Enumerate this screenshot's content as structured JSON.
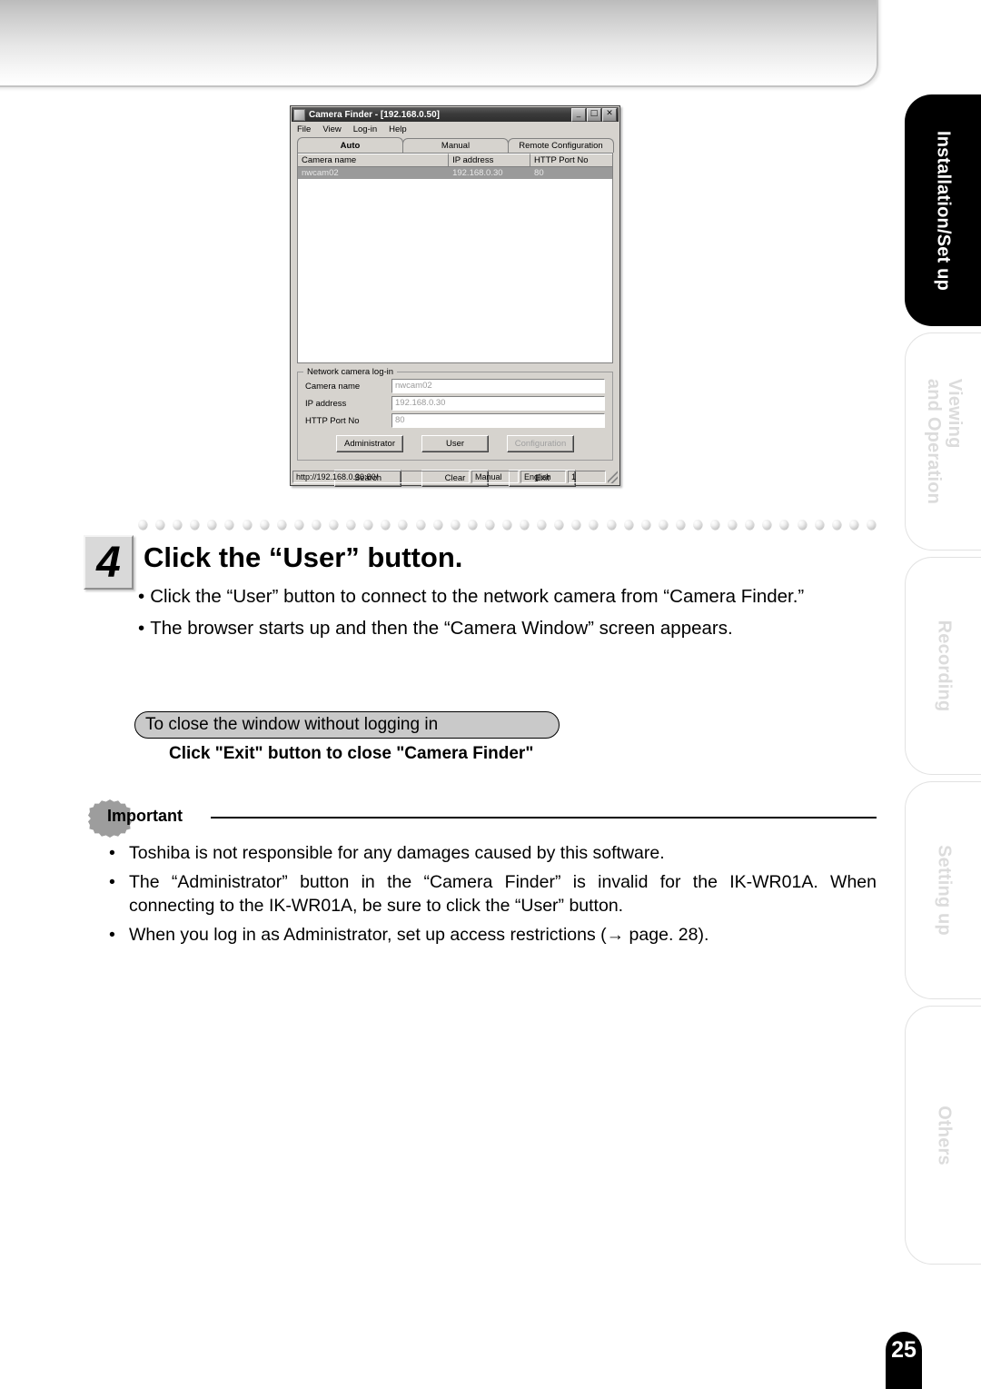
{
  "page": {
    "number": "25"
  },
  "side_tabs": [
    {
      "label": "Installation/Set up",
      "active": true
    },
    {
      "label": "Viewing\nand Operation",
      "active": false
    },
    {
      "label": "Recording",
      "active": false
    },
    {
      "label": "Setting up",
      "active": false
    },
    {
      "label": "Others",
      "active": false
    }
  ],
  "side_tabs_text": {
    "t0": "Installation/Set up",
    "t1_line1": "Viewing",
    "t1_line2": "and Operation",
    "t2": "Recording",
    "t3": "Setting up",
    "t4": "Others"
  },
  "dialog": {
    "title": "Camera Finder  -  [192.168.0.50]",
    "window_buttons": {
      "minimize": "_",
      "maximize": "□",
      "close": "✕"
    },
    "menu": [
      "File",
      "View",
      "Log-in",
      "Help"
    ],
    "tabs": [
      {
        "label": "Auto",
        "selected": true
      },
      {
        "label": "Manual",
        "selected": false
      },
      {
        "label": "Remote Configuration",
        "selected": false
      }
    ],
    "list": {
      "columns": [
        "Camera name",
        "IP address",
        "HTTP Port No"
      ],
      "rows": [
        {
          "camera_name": "nwcam02",
          "ip_address": "192.168.0.30",
          "http_port": "80",
          "selected": true
        }
      ]
    },
    "group": {
      "legend": "Network camera log-in",
      "fields": [
        {
          "label": "Camera name",
          "value": "nwcam02"
        },
        {
          "label": "IP address",
          "value": "192.168.0.30"
        },
        {
          "label": "HTTP Port No",
          "value": "80"
        }
      ],
      "buttons": [
        {
          "label": "Administrator",
          "disabled": false
        },
        {
          "label": "User",
          "disabled": false
        },
        {
          "label": "Configuration",
          "disabled": true
        }
      ]
    },
    "bottom_buttons": [
      {
        "label": "Search"
      },
      {
        "label": "Clear"
      },
      {
        "label": "Exit"
      }
    ],
    "statusbar": {
      "url": "http://192.168.0.30:80/",
      "mode": "Manual",
      "language": "English",
      "count": "1"
    }
  },
  "step": {
    "number": "4",
    "title": "Click the “User” button.",
    "bullets": [
      "Click the “User” button to connect to the network camera from “Camera Finder.”",
      "The browser starts up and then the “Camera Window” screen appears."
    ],
    "bullet_dot": "•"
  },
  "subsection": {
    "pill_label": "To close the window without logging in",
    "heading": "Click \"Exit\" button to close \"Camera Finder\""
  },
  "important": {
    "label": "Important",
    "bullet_dot": "•",
    "items": [
      "Toshiba is not responsible for any damages caused by this software.",
      "The “Administrator” button in the “Camera Finder” is invalid for the IK-WR01A. When connecting to the IK-WR01A, be sure to click the “User” button.",
      "When you log in as Administrator, set up access restrictions (→ page. 28)."
    ],
    "item2_line1": "The “Administrator” button in the “Camera Finder” is invalid for the IK-WR01A. When",
    "item2_line2": "connecting to the IK-WR01A, be sure to click the “User” button."
  }
}
